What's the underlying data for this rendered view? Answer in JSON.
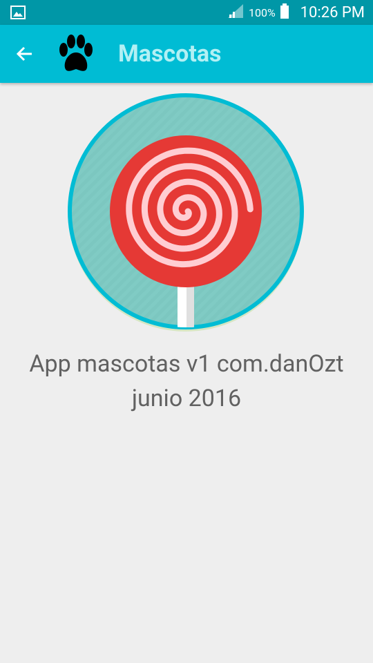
{
  "status_bar": {
    "battery_percent": "100%",
    "time": "10:26 PM",
    "icons": [
      "gallery-notification-icon",
      "signal-icon",
      "battery-icon"
    ]
  },
  "app_bar": {
    "title": "Mascotas",
    "back_icon": "arrow-left-icon",
    "logo_icon": "paw-icon"
  },
  "about": {
    "line1": "App mascotas v1 com.danOzt",
    "line2": "junio 2016"
  },
  "colors": {
    "status_bar": "#0097a7",
    "app_bar": "#00bcd4",
    "title_text": "#b2f0f4",
    "background": "#eeeeee",
    "body_text": "#616161",
    "logo_ring": "#00bcd4",
    "logo_fill": "#80cbc4",
    "lollipop_red": "#e53935",
    "lollipop_swirl": "#ffcdd2"
  }
}
